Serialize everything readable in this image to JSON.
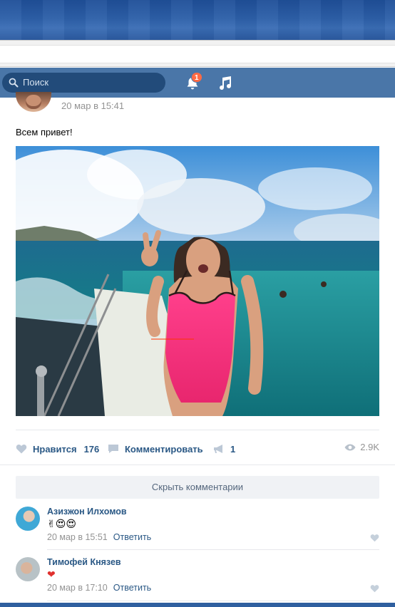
{
  "header": {
    "search_placeholder": "Поиск",
    "notifications_count": "1"
  },
  "post": {
    "date": "20 мар в 15:41",
    "text": "Всем привет!",
    "actions": {
      "like_label": "Нравится",
      "like_count": "176",
      "comment_label": "Комментировать",
      "share_count": "1",
      "views": "2.9K"
    }
  },
  "comments_section": {
    "hide_label": "Скрыть комментарии",
    "comments": [
      {
        "author": "Азизжон Илхомов",
        "text": "✌😍😍",
        "date": "20 мар в 15:51",
        "reply_label": "Ответить"
      },
      {
        "author": "Тимофей Князев",
        "text": "❤",
        "date": "20 мар в 17:10",
        "reply_label": "Ответить"
      }
    ]
  },
  "colors": {
    "vk_blue": "#4a76a8",
    "link": "#2a5885",
    "muted": "#939393",
    "badge": "#ff6a43"
  }
}
